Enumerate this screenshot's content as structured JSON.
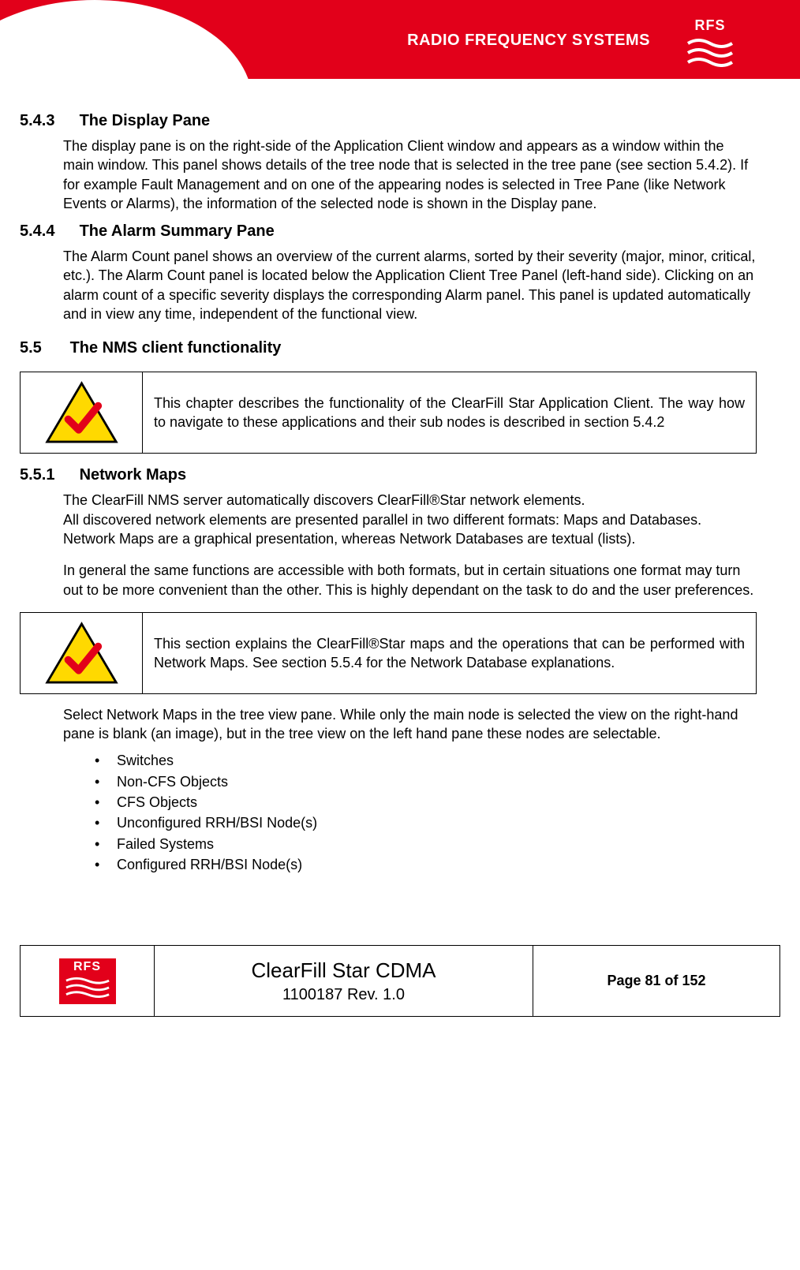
{
  "brand": "RADIO FREQUENCY SYSTEMS",
  "logo_text": "RFS",
  "sections": {
    "s543_num": "5.4.3",
    "s543_title": "The Display Pane",
    "s543_body": "The display pane is on the right-side of the Application Client window and appears as a window within the main window. This panel shows details of the tree node that is selected in the tree pane (see section 5.4.2). If for example Fault Management and on one of the appearing nodes is selected in Tree Pane (like Network Events or Alarms), the information of the selected node is shown in the Display pane.",
    "s544_num": "5.4.4",
    "s544_title": "The Alarm Summary Pane",
    "s544_body": "The Alarm Count panel shows an overview of the current alarms, sorted by their severity (major, minor, critical, etc.). The Alarm Count panel is located below the Application Client Tree Panel (left-hand side). Clicking on an alarm count of a specific severity displays the corresponding Alarm panel. This panel is updated automatically and in view any time, independent of the functional view.",
    "s55_num": "5.5",
    "s55_title": "The NMS client functionality",
    "note1": "This chapter describes the functionality of the ClearFill Star Application Client. The way how to navigate to these applications and their sub nodes is described in section 5.4.2",
    "s551_num": "5.5.1",
    "s551_title": "Network Maps",
    "s551_body1": "The ClearFill NMS server automatically discovers ClearFill®Star network elements.\nAll discovered network elements are presented parallel in two different formats: Maps and Databases.\nNetwork Maps are a graphical presentation, whereas Network Databases are textual (lists).",
    "s551_body2": "In general the same functions are accessible with both formats, but in certain situations one format may turn out to be more convenient than the other. This is highly dependant on the task to do and the user preferences.",
    "note2": "This section explains the ClearFill®Star maps and the operations that can be performed with Network Maps. See section 5.5.4 for the Network Database explanations.",
    "s551_body3": "Select Network Maps in the tree view pane. While only the main node is selected the view on the right-hand pane is blank (an image), but in the tree view on the left hand pane these nodes are selectable.",
    "bullets": [
      "Switches",
      "Non-CFS Objects",
      "CFS Objects",
      "Unconfigured RRH/BSI Node(s)",
      "Failed Systems",
      "Configured RRH/BSI Node(s)"
    ]
  },
  "footer": {
    "title": "ClearFill Star CDMA",
    "rev": "1100187 Rev. 1.0",
    "page": "Page 81 of 152"
  }
}
